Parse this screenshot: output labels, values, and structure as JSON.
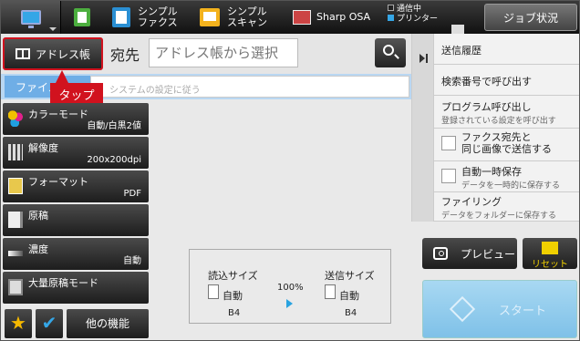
{
  "topbar": {
    "tabs": [
      {
        "label": ""
      },
      {
        "label": ""
      },
      {
        "label": "シンプル\nファクス"
      },
      {
        "label": "シンプル\nスキャン"
      },
      {
        "label": "Sharp OSA"
      }
    ],
    "status": {
      "comm": "通信中",
      "printer": "プリンター"
    },
    "job_status": "ジョブ状況"
  },
  "address": {
    "book_button": "アドレス帳",
    "dest_label": "宛先",
    "dest_placeholder": "アドレス帳から選択"
  },
  "filing": {
    "tab": "ファイル",
    "field": "システムの設定に従う"
  },
  "callout": "タップ",
  "functions": [
    {
      "label": "カラーモード",
      "value": "自動/白黒2値"
    },
    {
      "label": "解像度",
      "value": "200x200dpi"
    },
    {
      "label": "フォーマット",
      "value": "PDF"
    },
    {
      "label": "原稿",
      "value": ""
    },
    {
      "label": "濃度",
      "value": "自動"
    },
    {
      "label": "大量原稿モード",
      "value": ""
    }
  ],
  "bottom": {
    "other": "他の機能"
  },
  "size": {
    "read_label": "読込サイズ",
    "send_label": "送信サイズ",
    "read_mode": "自動",
    "send_mode": "自動",
    "read_paper": "B4",
    "send_paper": "B4",
    "ratio": "100%"
  },
  "right_panel": {
    "items": [
      {
        "title": "送信履歴",
        "sub": ""
      },
      {
        "title": "検索番号で呼び出す",
        "sub": ""
      },
      {
        "title": "プログラム呼び出し",
        "sub": "登録されている設定を呼び出す"
      },
      {
        "title": "ファクス宛先と\n同じ画像で送信する",
        "sub": ""
      },
      {
        "title": "自動一時保存",
        "sub": "データを一時的に保存する"
      },
      {
        "title": "ファイリング",
        "sub": "データをフォルダーに保存する"
      }
    ]
  },
  "actions": {
    "preview": "プレビュー",
    "reset": "リセット",
    "start": "スタート"
  }
}
